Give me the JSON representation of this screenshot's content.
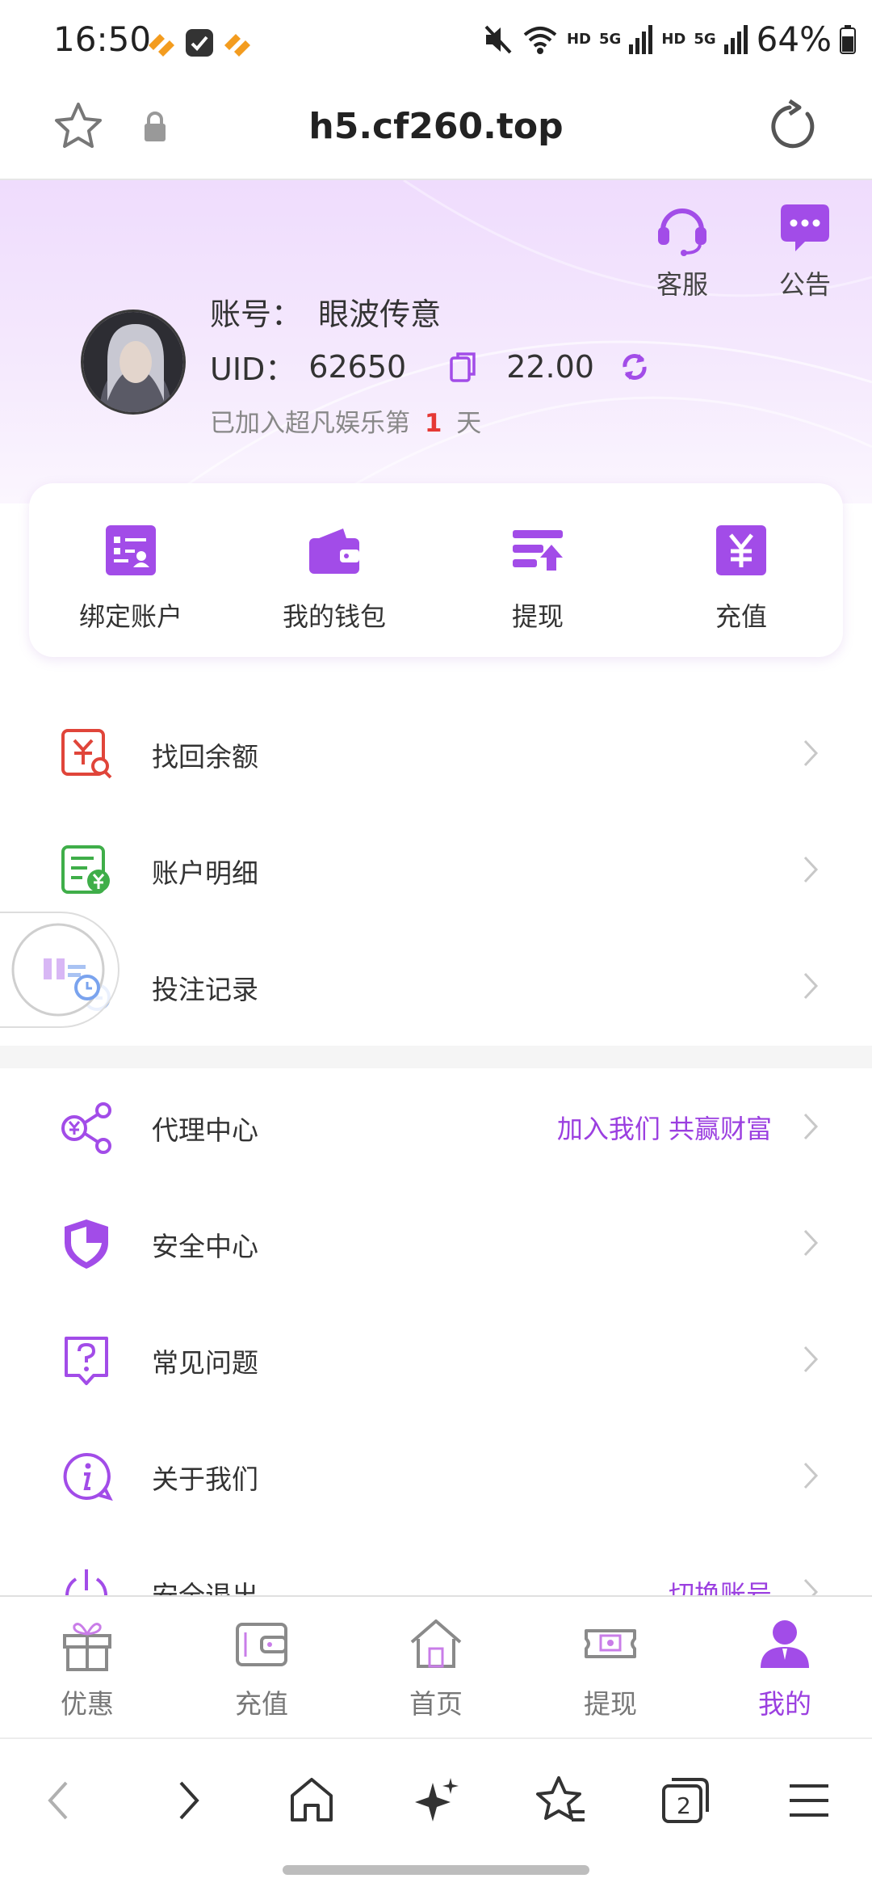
{
  "status_bar": {
    "time": "16:50",
    "battery": "64%",
    "net1": "HD",
    "net2": "5G",
    "net3": "HD",
    "net4": "5G"
  },
  "browser": {
    "url": "h5.cf260.top"
  },
  "header": {
    "service_label": "客服",
    "notice_label": "公告",
    "account_prefix": "账号：",
    "account_name": "眼波传意",
    "uid_prefix": "UID：",
    "uid_value": "62650",
    "balance": "22.00",
    "join_prefix": "已加入超凡娱乐第",
    "join_days": "1",
    "join_suffix": "天"
  },
  "quick_actions": [
    {
      "label": "绑定账户",
      "icon": "bind-account-icon"
    },
    {
      "label": "我的钱包",
      "icon": "wallet-icon"
    },
    {
      "label": "提现",
      "icon": "withdraw-icon"
    },
    {
      "label": "充值",
      "icon": "recharge-icon"
    }
  ],
  "menu_group1": [
    {
      "label": "找回余额",
      "icon": "recover-balance-icon"
    },
    {
      "label": "账户明细",
      "icon": "account-detail-icon"
    },
    {
      "label": "投注记录",
      "icon": "bet-record-icon"
    }
  ],
  "menu_group2": [
    {
      "label": "代理中心",
      "tag": "加入我们 共赢财富",
      "icon": "agent-icon"
    },
    {
      "label": "安全中心",
      "icon": "shield-icon"
    },
    {
      "label": "常见问题",
      "icon": "faq-icon"
    },
    {
      "label": "关于我们",
      "icon": "info-icon"
    },
    {
      "label": "安全退出",
      "tag": "切换账号",
      "icon": "power-icon"
    }
  ],
  "tabs": [
    {
      "label": "优惠",
      "icon": "gift-icon"
    },
    {
      "label": "充值",
      "icon": "wallet-icon"
    },
    {
      "label": "首页",
      "icon": "home-icon"
    },
    {
      "label": "提现",
      "icon": "cash-icon"
    },
    {
      "label": "我的",
      "icon": "user-icon",
      "active": true
    }
  ],
  "browser_nav": {
    "tab_count": "2"
  },
  "colors": {
    "accent": "#9b3fe0",
    "red": "#e53935",
    "green": "#3fae49"
  }
}
